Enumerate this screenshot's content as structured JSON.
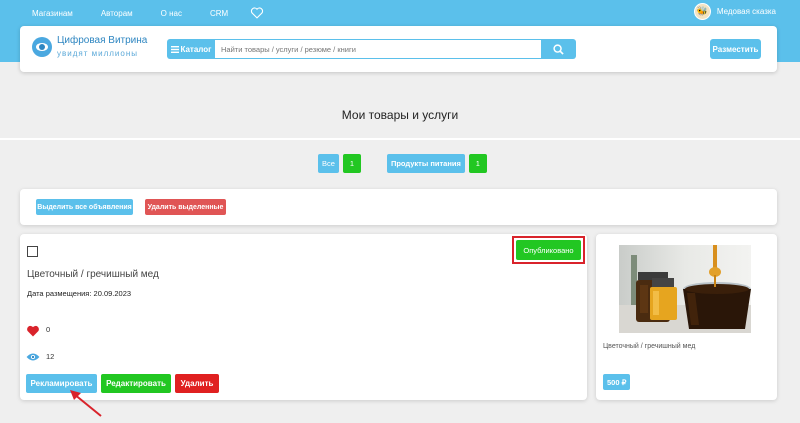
{
  "top_nav": {
    "items": [
      "Магазинам",
      "Авторам",
      "О нас",
      "CRM"
    ],
    "user_name": "Медовая сказка"
  },
  "header": {
    "logo_title": "Цифровая Витрина",
    "logo_subtitle": "увидят миллионы",
    "catalog_label": "Каталог",
    "search_placeholder": "Найти товары / услуги / резюме / книги",
    "post_label": "Разместить"
  },
  "page_title": "Мои товары и услуги",
  "filters": [
    {
      "label": "Все",
      "count": "1"
    },
    {
      "label": "Продукты питания",
      "count": "1"
    }
  ],
  "bulk_actions": {
    "select_all": "Выделить все объявления",
    "delete_selected": "Удалить выделенные"
  },
  "item": {
    "status": "Опубликовано",
    "title": "Цветочный / гречишный мед",
    "date": "Дата размещения: 20.09.2023",
    "likes": "0",
    "views": "12",
    "buttons": {
      "promote": "Рекламировать",
      "edit": "Редактировать",
      "delete": "Удалить"
    }
  },
  "preview": {
    "name": "Цветочный / гречишный мед",
    "price": "500 ₽"
  },
  "colors": {
    "accent": "#5bc0eb",
    "green": "#22c722",
    "red": "#e02020",
    "delete_selected": "#e05555",
    "highlight": "#d9232b"
  },
  "icons": {
    "heart": "heart-icon",
    "search": "search-icon",
    "eye": "eye-icon",
    "menu": "menu-icon"
  }
}
